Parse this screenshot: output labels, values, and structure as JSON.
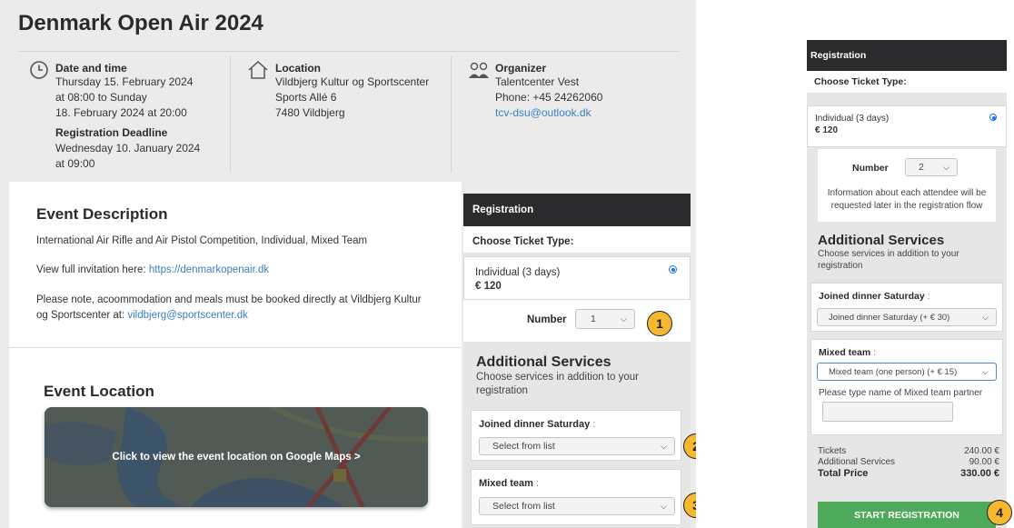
{
  "event": {
    "title": "Denmark Open Air 2024",
    "date_label": "Date and time",
    "date_lines": [
      "Thursday 15. February 2024",
      "at 08:00 to Sunday",
      "18. February 2024 at 20:00"
    ],
    "deadline_label": "Registration Deadline",
    "deadline_lines": [
      "Wednesday 10. January 2024",
      "at 09:00"
    ],
    "location_label": "Location",
    "location_lines": [
      "Vildbjerg Kultur og Sportscenter",
      "Sports Allé 6",
      "7480 Vildbjerg"
    ],
    "organizer_label": "Organizer",
    "organizer_lines": [
      "Talentcenter Vest",
      "Phone: +45 24262060"
    ],
    "organizer_email": "tcv-dsu@outlook.dk"
  },
  "description": {
    "heading": "Event Description",
    "line1": "International Air Rifle and Air Pistol Competition, Individual, Mixed Team",
    "invite_prefix": "View full invitation here: ",
    "invite_link": "https://denmarkopenair.dk",
    "note_line1": "Please note, acoommodation and meals must be booked directly at Vildbjerg Kultur",
    "note_line2_prefix": "og Sportscenter at: ",
    "note_email": "vildbjerg@sportscenter.dk"
  },
  "location_section": {
    "heading": "Event Location",
    "map_cta": "Click to view the event location on Google Maps >"
  },
  "registration_left": {
    "header": "Registration",
    "choose_ticket": "Choose Ticket Type:",
    "ticket_name": "Individual (3 days)",
    "ticket_price": "€ 120",
    "number_label": "Number",
    "number_value": "1",
    "additional_title": "Additional Services",
    "additional_sub": "Choose services in addition to your registration",
    "dinner_label": "Joined dinner Saturday",
    "dinner_value": "Select from list",
    "mixed_label": "Mixed team",
    "mixed_value": "Select from list",
    "colon": ":"
  },
  "badges": [
    "1",
    "2",
    "3",
    "4"
  ],
  "registration_right": {
    "header": "Registration",
    "choose_ticket": "Choose Ticket Type:",
    "ticket_name": "Individual (3 days)",
    "ticket_price": "€ 120",
    "number_label": "Number",
    "number_value": "2",
    "info_text": "Information about each attendee will be requested later in the registration flow",
    "additional_title": "Additional Services",
    "additional_sub": "Choose services in addition to your registration",
    "dinner_label": "Joined dinner Saturday",
    "dinner_value": "Joined dinner Saturday (+ € 30)",
    "mixed_label": "Mixed team",
    "mixed_value": "Mixed team (one person) (+ € 15)",
    "partner_label": "Please type name of Mixed team partner",
    "partner_value": "",
    "tickets_label": "Tickets",
    "tickets_value": "240.00 €",
    "services_label": "Additional Services",
    "services_value": "90.00 €",
    "total_label": "Total Price",
    "total_value": "330.00 €",
    "start_button": "START REGISTRATION",
    "colon": ":"
  },
  "colors": {
    "header_dark": "#2b2b2e",
    "link_blue": "#3a7fc1",
    "badge_yellow": "#f5b82e",
    "button_green": "#4ea95a"
  }
}
